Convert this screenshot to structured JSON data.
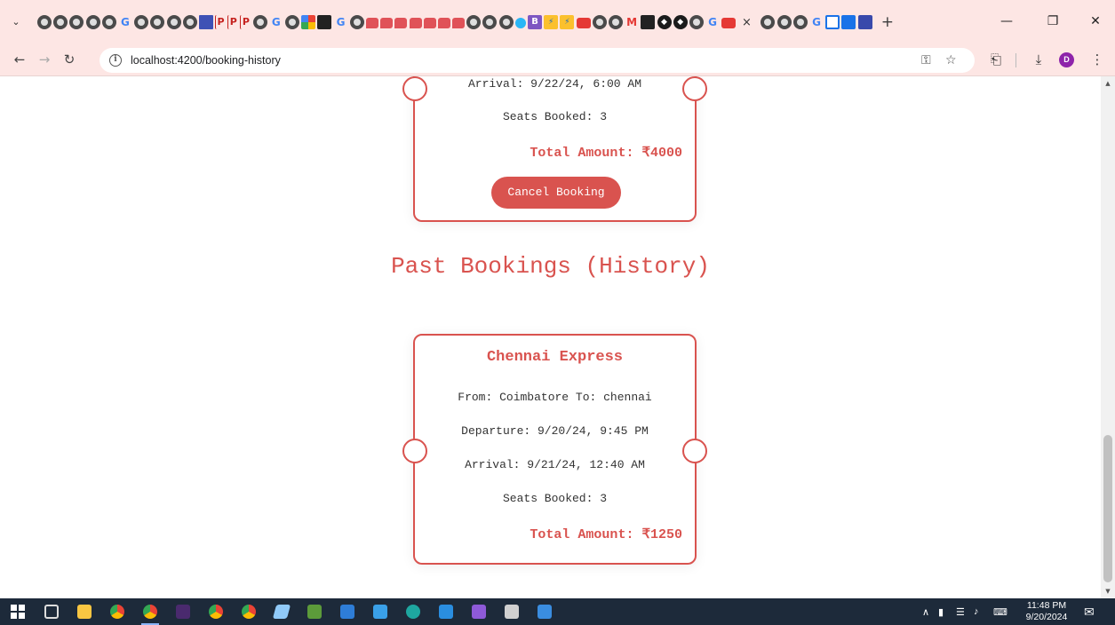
{
  "browser": {
    "tab_close": "×",
    "new_tab": "+",
    "url": "localhost:4200/booking-history",
    "profile_initial": "D"
  },
  "upcoming_booking": {
    "arrival": "Arrival: 9/22/24, 6:00 AM",
    "seats": "Seats Booked: 3",
    "total": "Total Amount: ₹4000",
    "cancel_label": "Cancel Booking"
  },
  "past_section": {
    "title": "Past Bookings (History)"
  },
  "past_booking": {
    "train_name": "Chennai Express",
    "route": "From: Coimbatore To: chennai",
    "departure": "Departure: 9/20/24, 9:45 PM",
    "arrival": "Arrival: 9/21/24, 12:40 AM",
    "seats": "Seats Booked: 3",
    "total": "Total Amount: ₹1250"
  },
  "taskbar": {
    "time": "11:48 PM",
    "date": "9/20/2024"
  },
  "colors": {
    "accent": "#d9534f",
    "tab_strip": "#fde6e4",
    "taskbar": "#1d2a3a"
  }
}
